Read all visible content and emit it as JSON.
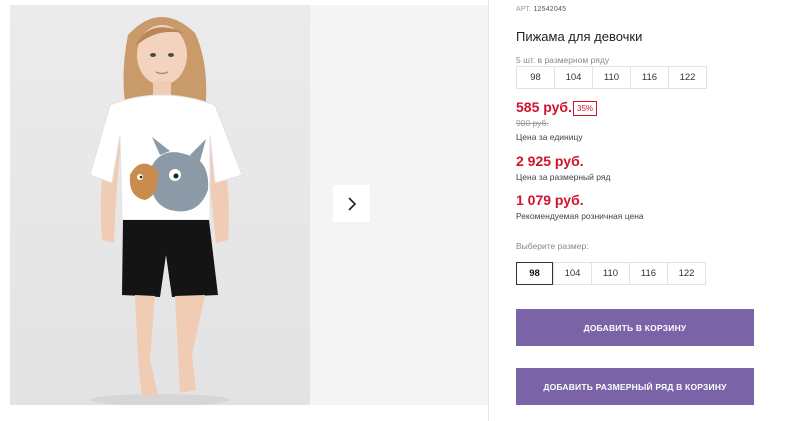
{
  "product": {
    "sku_label": "АРТ.",
    "sku_value": "12542045",
    "title": "Пижама для девочки",
    "pack_caption": "5 шт. в размерном ряду",
    "pack_sizes": [
      "98",
      "104",
      "110",
      "116",
      "122"
    ]
  },
  "pricing": {
    "unit_price": "585 руб.",
    "discount": "35%",
    "old_price": "900 руб.",
    "unit_note": "Цена за единицу",
    "row_price": "2 925 руб.",
    "row_note": "Цена за размерный ряд",
    "retail_price": "1 079 руб.",
    "retail_note": "Рекомендуемая розничная цена"
  },
  "size_picker": {
    "caption": "Выберите размер:",
    "sizes": [
      "98",
      "104",
      "110",
      "116",
      "122"
    ],
    "selected": "98"
  },
  "actions": {
    "add_to_cart": "ДОБАВИТЬ В КОРЗИНУ",
    "add_row_to_cart": "ДОБАВИТЬ РАЗМЕРНЫЙ РЯД В КОРЗИНУ"
  },
  "colors": {
    "accent_button": "#7a63a6",
    "price_red": "#d0142c"
  },
  "icons": {
    "next": "chevron-right-icon"
  }
}
